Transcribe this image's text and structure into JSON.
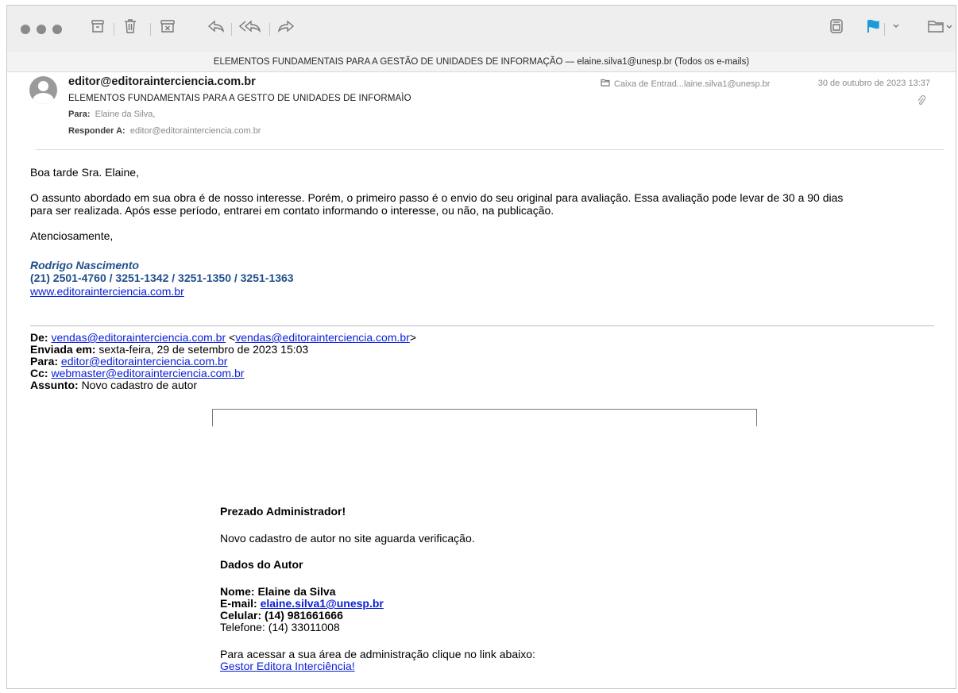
{
  "toolbar": {
    "icons": [
      "archive-icon",
      "trash-icon",
      "junk-icon",
      "reply-icon",
      "reply-all-icon",
      "forward-icon",
      "print-icon",
      "flag-icon",
      "chevron-down-icon",
      "move-to-folder-icon"
    ],
    "flag_color": "#1e9bd7"
  },
  "window": {
    "title": "ELEMENTOS FUNDAMENTAIS PARA A GESTÃO DE UNIDADES DE INFORMAÇÃO — elaine.silva1@unesp.br (Todos os e-mails)"
  },
  "header": {
    "sender": "editor@editorainterciencia.com.br",
    "subject": "ELEMENTOS FUNDAMENTAIS PARA A GESTΓO DE UNIDADES DE INFORMAÌO",
    "to_label": "Para:",
    "to_value": "Elaine da Silva,",
    "reply_label": "Responder A:",
    "reply_value": "editor@editorainterciencia.com.br",
    "mailbox": "Caixa de Entrad...laine.silva1@unesp.br",
    "date": "30 de outubro de 2023 13:37"
  },
  "message": {
    "greeting": "Boa tarde Sra. Elaine,",
    "para1_line1": "O assunto abordado em sua obra é de nosso interesse. Porém, o primeiro passo é o envio do seu original para avaliação. Essa avaliação pode levar de 30 a 90 dias",
    "para1_line2": "para ser realizada. Após esse período, entrarei em contato informando o interesse, ou não, na publicação.",
    "closing": "Atenciosamente,",
    "sig_name": "Rodrigo Nascimento",
    "sig_phones": "(21) 2501-4760 / 3251-1342 / 3251-1350 / 3251-1363",
    "sig_site": "www.editorainterciencia.com.br"
  },
  "forwarded": {
    "from_label": "De:",
    "from_link1": "vendas@editorainterciencia.com.br",
    "from_link2": "vendas@editorainterciencia.com.br",
    "sent_label": "Enviada em:",
    "sent_value": "sexta-feira, 29 de setembro de 2023 15:03",
    "to_label": "Para:",
    "to_link": "editor@editorainterciencia.com.br",
    "cc_label": "Cc:",
    "cc_link": "webmaster@editorainterciencia.com.br",
    "subject_label": "Assunto:",
    "subject_value": "Novo cadastro de autor"
  },
  "inner": {
    "heading": "Prezado Administrador!",
    "line": "Novo cadastro de autor no site aguarda verificação.",
    "data_heading": "Dados do Autor",
    "name": "Nome: Elaine da Silva",
    "email_label": "E-mail:",
    "email_link": "elaine.silva1@unesp.br",
    "cell": "Celular: (14) 981661666",
    "phone": "Telefone: (14) 33011008",
    "access": "Para acessar a sua área de administração clique no link abaixo:",
    "admin_link": "Gestor Editora Interciência!"
  }
}
